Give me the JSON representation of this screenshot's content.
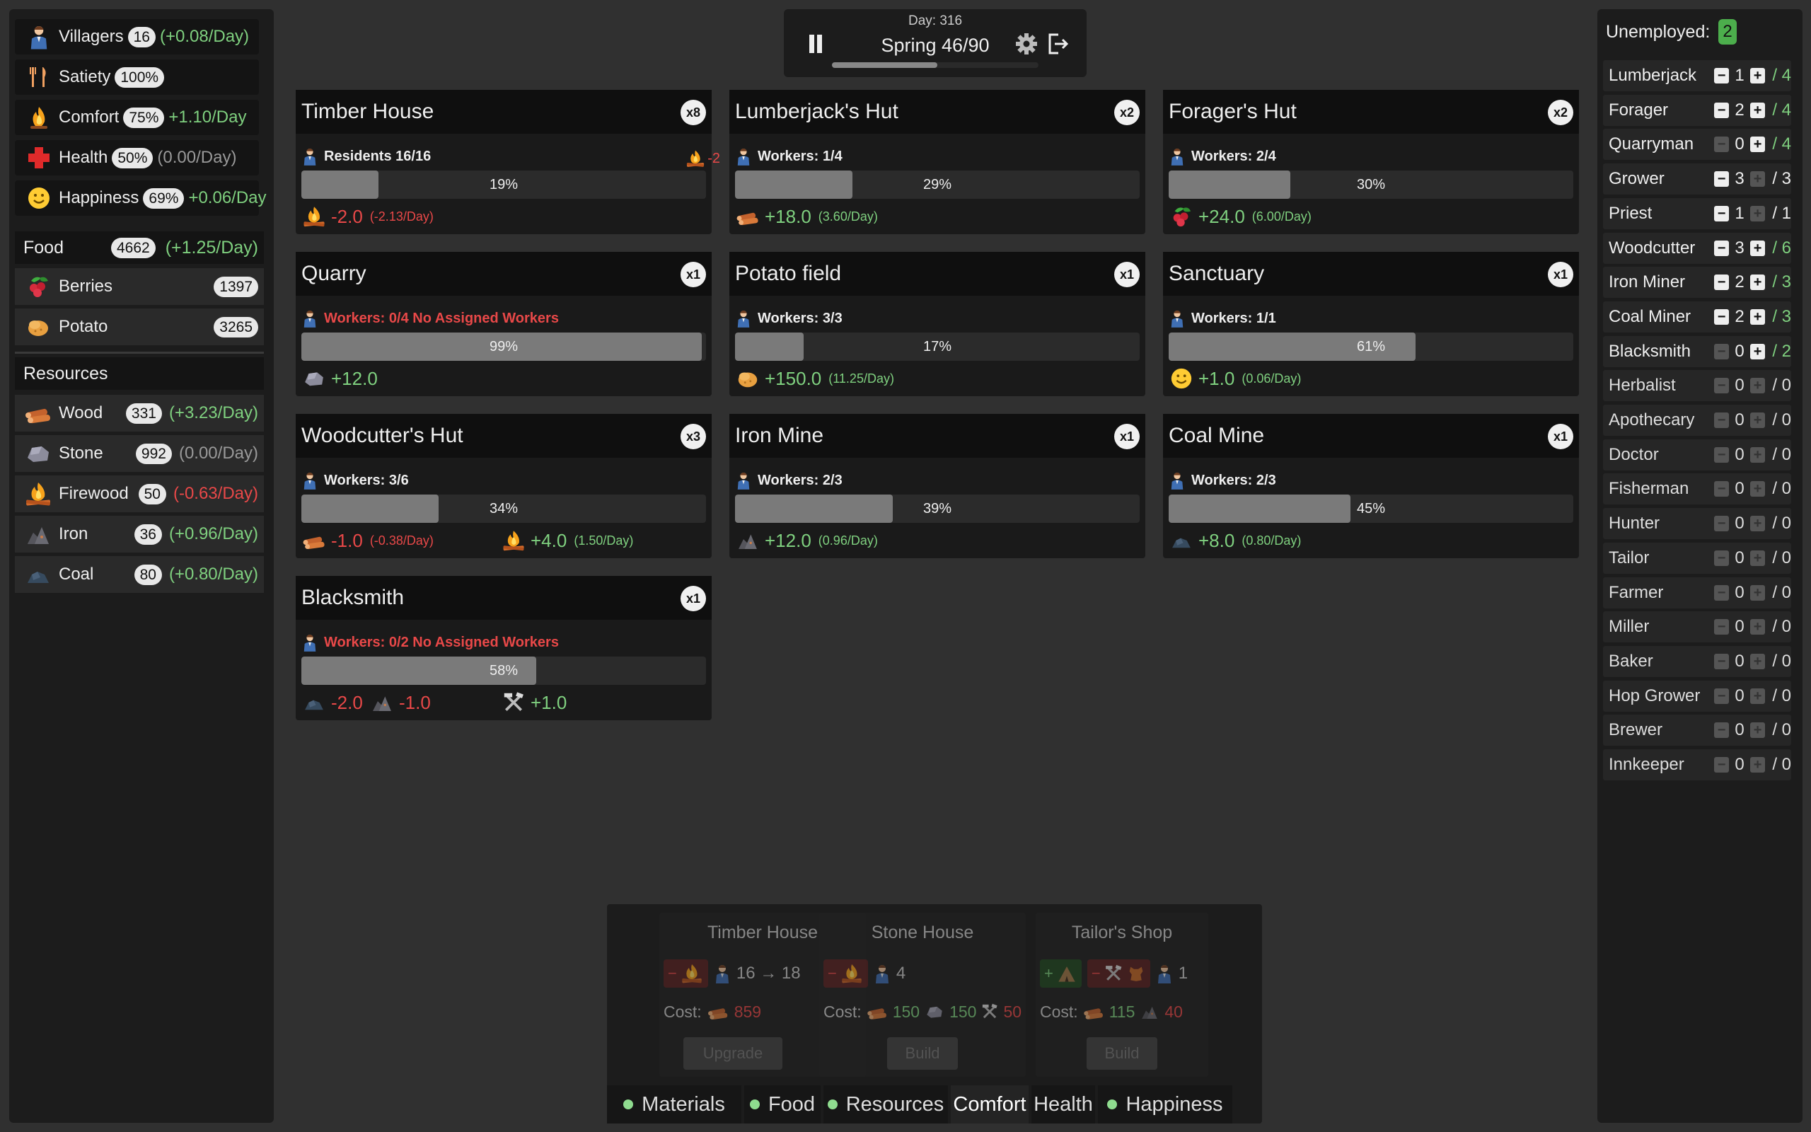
{
  "stats": [
    {
      "name": "Villagers",
      "value": "16",
      "change": "(+0.08/Day)",
      "tone": "green",
      "icon": "villager-icon"
    },
    {
      "name": "Satiety",
      "value": "100%",
      "change": "",
      "tone": "green",
      "icon": "fork-knife-icon"
    },
    {
      "name": "Comfort",
      "value": "75%",
      "change": "+1.10/Day",
      "tone": "green",
      "icon": "campfire-icon"
    },
    {
      "name": "Health",
      "value": "50%",
      "change": "(0.00/Day)",
      "tone": "muted",
      "icon": "red-cross-icon"
    },
    {
      "name": "Happiness",
      "value": "69%",
      "change": "+0.06/Day",
      "tone": "green",
      "icon": "smiley-icon"
    }
  ],
  "food": {
    "title": "Food",
    "total": "4662",
    "change": "(+1.25/Day)",
    "items": [
      {
        "name": "Berries",
        "value": "1397",
        "icon": "berries-icon"
      },
      {
        "name": "Potato",
        "value": "3265",
        "icon": "potato-icon"
      }
    ]
  },
  "resources": {
    "title": "Resources",
    "items": [
      {
        "name": "Wood",
        "value": "331",
        "change": "(+3.23/Day)",
        "tone": "green",
        "icon": "wood-logs-icon"
      },
      {
        "name": "Stone",
        "value": "992",
        "change": "(0.00/Day)",
        "tone": "muted",
        "icon": "stone-icon"
      },
      {
        "name": "Firewood",
        "value": "50",
        "change": "(-0.63/Day)",
        "tone": "red",
        "icon": "firewood-icon"
      },
      {
        "name": "Iron",
        "value": "36",
        "change": "(+0.96/Day)",
        "tone": "green",
        "icon": "iron-ore-icon"
      },
      {
        "name": "Coal",
        "value": "80",
        "change": "(+0.80/Day)",
        "tone": "green",
        "icon": "coal-icon"
      }
    ]
  },
  "topbar": {
    "day": "Day: 316",
    "season": "Spring 46/90",
    "progress": 0.51
  },
  "buildings": [
    {
      "name": "Timber House",
      "count": "x8",
      "workers": "Residents 16/16",
      "warn": false,
      "progress": 0.19,
      "pct": "19%",
      "side_alert": "-2",
      "outputs": [
        {
          "icon": "firewood-icon",
          "val": "-2.0",
          "rate": "(-2.13/Day)",
          "tone": "red"
        }
      ]
    },
    {
      "name": "Lumberjack's Hut",
      "count": "x2",
      "workers": "Workers: 1/4",
      "warn": false,
      "progress": 0.29,
      "pct": "29%",
      "outputs": [
        {
          "icon": "wood-logs-icon",
          "val": "+18.0",
          "rate": "(3.60/Day)",
          "tone": "green"
        }
      ]
    },
    {
      "name": "Forager's Hut",
      "count": "x2",
      "workers": "Workers: 2/4",
      "warn": false,
      "progress": 0.3,
      "pct": "30%",
      "outputs": [
        {
          "icon": "berries-icon",
          "val": "+24.0",
          "rate": "(6.00/Day)",
          "tone": "green"
        }
      ]
    },
    {
      "name": "Quarry",
      "count": "x1",
      "workers": "Workers: 0/4 No Assigned Workers",
      "warn": true,
      "progress": 0.99,
      "pct": "99%",
      "outputs": [
        {
          "icon": "stone-icon",
          "val": "+12.0",
          "rate": "",
          "tone": "green"
        }
      ]
    },
    {
      "name": "Potato field",
      "count": "x1",
      "workers": "Workers: 3/3",
      "warn": false,
      "progress": 0.17,
      "pct": "17%",
      "outputs": [
        {
          "icon": "potato-icon",
          "val": "+150.0",
          "rate": "(11.25/Day)",
          "tone": "green"
        }
      ]
    },
    {
      "name": "Sanctuary",
      "count": "x1",
      "workers": "Workers: 1/1",
      "warn": false,
      "progress": 0.61,
      "pct": "61%",
      "outputs": [
        {
          "icon": "smiley-icon",
          "val": "+1.0",
          "rate": "(0.06/Day)",
          "tone": "green"
        }
      ]
    },
    {
      "name": "Woodcutter's Hut",
      "count": "x3",
      "workers": "Workers: 3/6",
      "warn": false,
      "progress": 0.34,
      "pct": "34%",
      "outputs": [
        {
          "icon": "wood-logs-icon",
          "val": "-1.0",
          "rate": "(-0.38/Day)",
          "tone": "red"
        },
        {
          "icon": "firewood-icon",
          "val": "+4.0",
          "rate": "(1.50/Day)",
          "tone": "green"
        }
      ]
    },
    {
      "name": "Iron Mine",
      "count": "x1",
      "workers": "Workers: 2/3",
      "warn": false,
      "progress": 0.39,
      "pct": "39%",
      "outputs": [
        {
          "icon": "iron-ore-icon",
          "val": "+12.0",
          "rate": "(0.96/Day)",
          "tone": "green"
        }
      ]
    },
    {
      "name": "Coal Mine",
      "count": "x1",
      "workers": "Workers: 2/3",
      "warn": false,
      "progress": 0.45,
      "pct": "45%",
      "outputs": [
        {
          "icon": "coal-icon",
          "val": "+8.0",
          "rate": "(0.80/Day)",
          "tone": "green"
        }
      ]
    },
    {
      "name": "Blacksmith",
      "count": "x1",
      "workers": "Workers: 0/2 No Assigned Workers",
      "warn": true,
      "progress": 0.58,
      "pct": "58%",
      "outputs": [
        {
          "icon": "coal-icon",
          "val": "-2.0",
          "rate": "",
          "tone": "red"
        },
        {
          "icon": "iron-ore-icon",
          "val": "-1.0",
          "rate": "",
          "tone": "red"
        },
        {
          "icon": "tools-icon",
          "val": "+1.0",
          "rate": "",
          "tone": "green"
        }
      ]
    }
  ],
  "jobs": {
    "unemployed_label": "Unemployed:",
    "unemployed": "2",
    "items": [
      {
        "name": "Lumberjack",
        "count": "1",
        "cap": "/ 4",
        "minus": true,
        "plus": true
      },
      {
        "name": "Forager",
        "count": "2",
        "cap": "/ 4",
        "minus": true,
        "plus": true
      },
      {
        "name": "Quarryman",
        "count": "0",
        "cap": "/ 4",
        "minus": false,
        "plus": true
      },
      {
        "name": "Grower",
        "count": "3",
        "cap": "/ 3",
        "minus": true,
        "plus": false
      },
      {
        "name": "Priest",
        "count": "1",
        "cap": "/ 1",
        "minus": true,
        "plus": false
      },
      {
        "name": "Woodcutter",
        "count": "3",
        "cap": "/ 6",
        "minus": true,
        "plus": true
      },
      {
        "name": "Iron Miner",
        "count": "2",
        "cap": "/ 3",
        "minus": true,
        "plus": true
      },
      {
        "name": "Coal Miner",
        "count": "2",
        "cap": "/ 3",
        "minus": true,
        "plus": true
      },
      {
        "name": "Blacksmith",
        "count": "0",
        "cap": "/ 2",
        "minus": false,
        "plus": true
      },
      {
        "name": "Herbalist",
        "count": "0",
        "cap": "/ 0",
        "minus": false,
        "plus": false
      },
      {
        "name": "Apothecary",
        "count": "0",
        "cap": "/ 0",
        "minus": false,
        "plus": false
      },
      {
        "name": "Doctor",
        "count": "0",
        "cap": "/ 0",
        "minus": false,
        "plus": false
      },
      {
        "name": "Fisherman",
        "count": "0",
        "cap": "/ 0",
        "minus": false,
        "plus": false
      },
      {
        "name": "Hunter",
        "count": "0",
        "cap": "/ 0",
        "minus": false,
        "plus": false
      },
      {
        "name": "Tailor",
        "count": "0",
        "cap": "/ 0",
        "minus": false,
        "plus": false
      },
      {
        "name": "Farmer",
        "count": "0",
        "cap": "/ 0",
        "minus": false,
        "plus": false
      },
      {
        "name": "Miller",
        "count": "0",
        "cap": "/ 0",
        "minus": false,
        "plus": false
      },
      {
        "name": "Baker",
        "count": "0",
        "cap": "/ 0",
        "minus": false,
        "plus": false
      },
      {
        "name": "Hop Grower",
        "count": "0",
        "cap": "/ 0",
        "minus": false,
        "plus": false
      },
      {
        "name": "Brewer",
        "count": "0",
        "cap": "/ 0",
        "minus": false,
        "plus": false
      },
      {
        "name": "Innkeeper",
        "count": "0",
        "cap": "/ 0",
        "minus": false,
        "plus": false
      }
    ]
  },
  "build_menu": {
    "cost_label": "Cost:",
    "cards": [
      {
        "title": "Timber House",
        "residents": "16 → 18",
        "cost_wood": "859",
        "button": "Upgrade"
      },
      {
        "title": "Stone House",
        "residents": "4",
        "cost_wood": "150",
        "cost_stone": "150",
        "cost_tools": "50",
        "button": "Build"
      },
      {
        "title": "Tailor's Shop",
        "workers": "1",
        "cost_wood": "115",
        "cost_iron": "40",
        "button": "Build"
      }
    ],
    "tabs": [
      {
        "label": "Materials",
        "dot": true,
        "active": false
      },
      {
        "label": "Food",
        "dot": true,
        "active": false
      },
      {
        "label": "Resources",
        "dot": true,
        "active": false
      },
      {
        "label": "Comfort",
        "dot": false,
        "active": true
      },
      {
        "label": "Health",
        "dot": false,
        "active": false
      },
      {
        "label": "Happiness",
        "dot": true,
        "active": false
      }
    ]
  },
  "colors": {
    "positive": "#7fd07f",
    "negative": "#e84848",
    "panel": "#1c1c1c",
    "background": "#303030"
  }
}
